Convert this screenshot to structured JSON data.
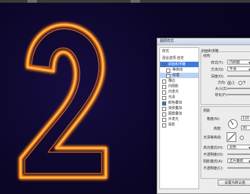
{
  "dialog": {
    "title": "图层样式",
    "left_header": "样式",
    "blend_options": "混合选项:自定",
    "items": [
      {
        "label": "斜面和浮雕",
        "checked": true,
        "selected": true,
        "sub": false
      },
      {
        "label": "等高线",
        "checked": false,
        "selected": false,
        "sub": true
      },
      {
        "label": "纹理",
        "checked": false,
        "selected": false,
        "sub": true,
        "subsel": true
      },
      {
        "label": "描边",
        "checked": false,
        "selected": false,
        "sub": false
      },
      {
        "label": "内阴影",
        "checked": false,
        "selected": false,
        "sub": false
      },
      {
        "label": "内发光",
        "checked": false,
        "selected": false,
        "sub": false
      },
      {
        "label": "光泽",
        "checked": false,
        "selected": false,
        "sub": false
      },
      {
        "label": "颜色叠加",
        "checked": true,
        "selected": false,
        "sub": false
      },
      {
        "label": "渐变叠加",
        "checked": false,
        "selected": false,
        "sub": false
      },
      {
        "label": "图案叠加",
        "checked": false,
        "selected": false,
        "sub": false
      },
      {
        "label": "外发光",
        "checked": false,
        "selected": false,
        "sub": false
      },
      {
        "label": "投影",
        "checked": false,
        "selected": false,
        "sub": false
      }
    ],
    "bevel": {
      "group_title": "斜面和浮雕",
      "structure_title": "结构",
      "style_label": "样式(T):",
      "style_value": "内斜面",
      "technique_label": "方法(Q):",
      "technique_value": "平滑",
      "depth_label": "深度(D):",
      "direction_label": "方向:",
      "direction_up": "上",
      "direction_down": "下",
      "size_label": "大小(Z):",
      "soften_label": "软化(F):",
      "shading_title": "阴影",
      "angle_label": "角度(N):",
      "angle_value": "120",
      "altitude_label": "高度:",
      "altitude_value": "30",
      "gloss_label": "光泽等高线:",
      "highlight_mode_label": "高光模式(H):",
      "highlight_mode_value": "滤色",
      "highlight_opacity_label": "不透明度(O):",
      "shadow_mode_label": "阴影模式(A):",
      "shadow_mode_value": "正片叠底",
      "shadow_opacity_label": "不透明度(C):"
    },
    "default_button": "设置为默认值"
  },
  "colors": {
    "glow": "#ff8a1c",
    "core": "#ffd36a",
    "background": "#0b0624",
    "selected": "#3a7be0"
  }
}
